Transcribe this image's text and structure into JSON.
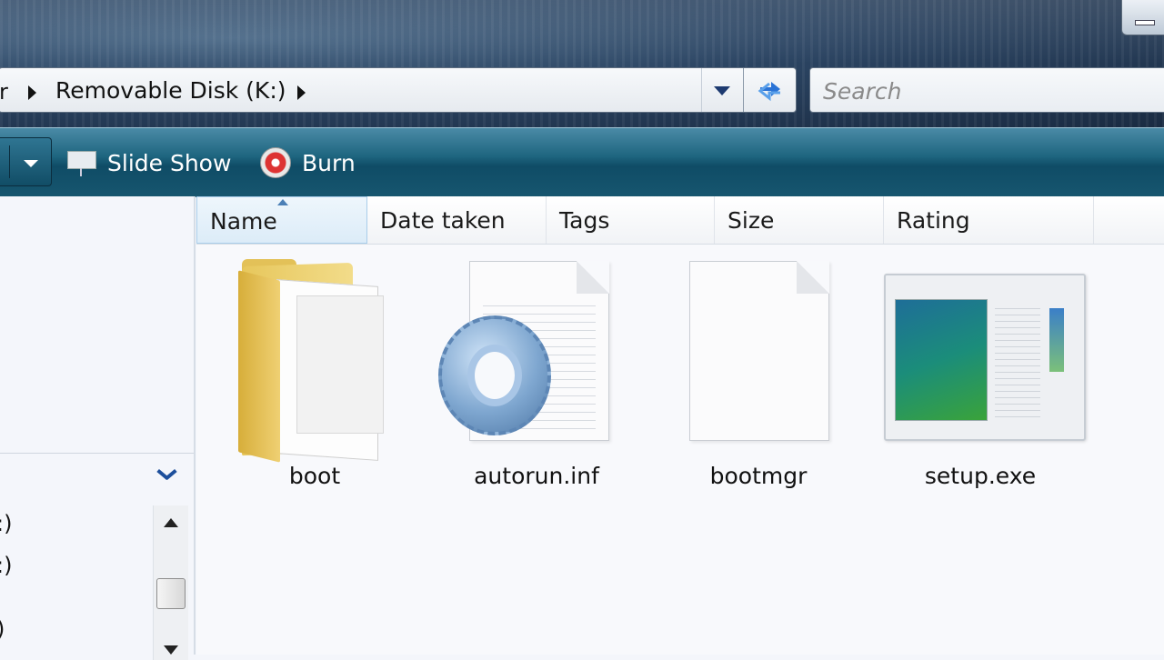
{
  "window": {
    "title_visible": false
  },
  "address_bar": {
    "crumb_prev": "r",
    "location": "Removable Disk (K:)"
  },
  "search": {
    "placeholder": "Search"
  },
  "toolbar": {
    "slideshow_label": "Slide Show",
    "burn_label": "Burn"
  },
  "columns": [
    {
      "label": "Name",
      "sorted": true
    },
    {
      "label": "Date taken"
    },
    {
      "label": "Tags"
    },
    {
      "label": "Size"
    },
    {
      "label": "Rating"
    }
  ],
  "files": [
    {
      "name": "boot",
      "icon": "folder-icon"
    },
    {
      "name": "autorun.inf",
      "icon": "settings-file-icon"
    },
    {
      "name": "bootmgr",
      "icon": "blank-file-icon"
    },
    {
      "name": "setup.exe",
      "icon": "application-icon"
    }
  ],
  "nav_tree": {
    "items": [
      ":)",
      ":)",
      ")"
    ]
  }
}
